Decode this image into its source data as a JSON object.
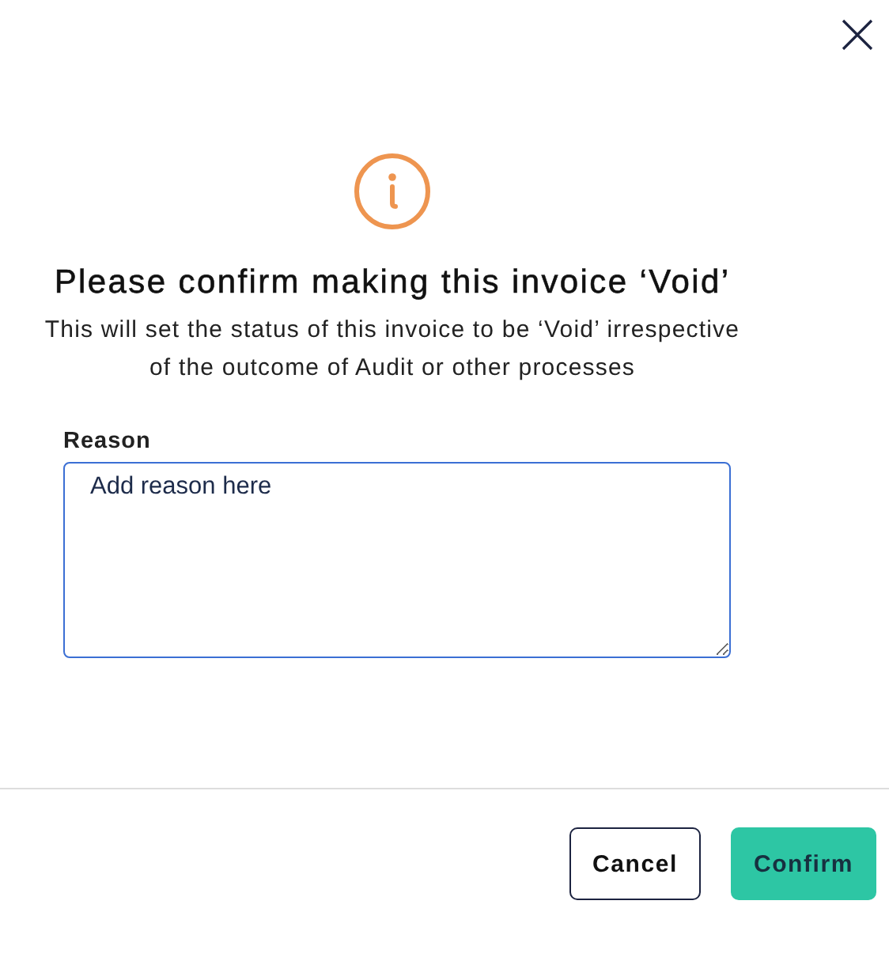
{
  "dialog": {
    "title": "Please confirm making this invoice ‘Void’",
    "message": "This will set the status of this invoice to be ‘Void’ irrespective of the outcome of Audit or other processes",
    "reason": {
      "label": "Reason",
      "value": "Add reason here",
      "focused": true
    },
    "buttons": [
      {
        "kind": "secondary",
        "label": "Cancel"
      },
      {
        "kind": "primary",
        "label": "Confirm"
      }
    ]
  }
}
